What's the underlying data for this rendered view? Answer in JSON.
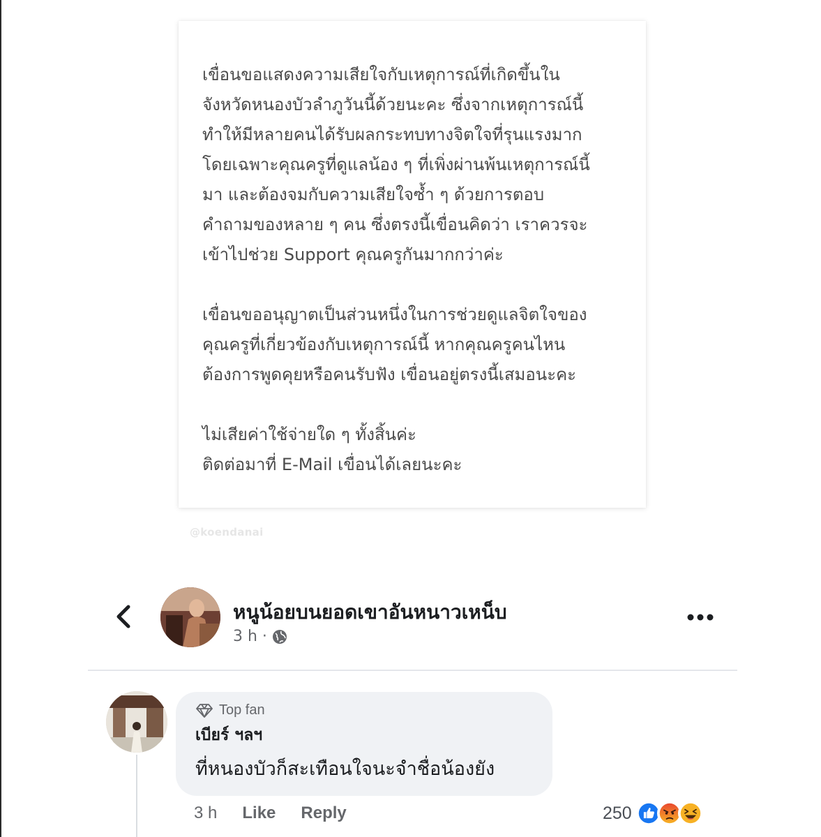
{
  "statement": {
    "paragraphs": [
      "เขื่อนขอแสดงความเสียใจกับเหตุการณ์ที่เกิดขึ้นใน\nจังหวัดหนองบัวลำภูวันนี้ด้วยนะคะ ซึ่งจากเหตุการณ์นี้\nทำให้มีหลายคนได้รับผลกระทบทางจิตใจที่รุนแรงมาก\nโดยเฉพาะคุณครูที่ดูแลน้อง ๆ ที่เพิ่งผ่านพ้นเหตุการณ์นี้\nมา และต้องจมกับความเสียใจซ้ำ ๆ ด้วยการตอบ\nคำถามของหลาย ๆ คน ซึ่งตรงนี้เขื่อนคิดว่า เราควรจะ\nเข้าไปช่วย Support คุณครูกันมากกว่าค่ะ",
      "เขื่อนขออนุญาตเป็นส่วนหนึ่งในการช่วยดูแลจิตใจของ\nคุณครูที่เกี่ยวข้องกับเหตุการณ์นี้  หากคุณครูคนไหน\nต้องการพูดคุยหรือคนรับฟัง เขื่อนอยู่ตรงนี้เสมอนะคะ",
      "ไม่เสียค่าใช้จ่ายใด ๆ ทั้งสิ้นค่ะ\nติดต่อมาที่ E-Mail เขื่อนได้เลยนะคะ"
    ]
  },
  "watermark": "@koendanai",
  "post": {
    "author": "หนูน้อยบนยอดเขาอันหนาวเหน็บ",
    "time": "3 h ·",
    "icons": {
      "back": "chevron-left-icon",
      "privacy": "globe-icon",
      "more": "more-horizontal-icon"
    }
  },
  "comment": {
    "badge": "Top fan",
    "author": "เบียร์ ฯลฯ",
    "text": "ที่หนองบัวก็สะเทือนใจนะจำชื่อน้องยัง",
    "time": "3 h",
    "like_label": "Like",
    "reply_label": "Reply",
    "reaction_count": "250",
    "reactions": [
      "like",
      "angry",
      "haha"
    ],
    "colors": {
      "like": "#1877f2",
      "angry": "#e9710f",
      "haha": "#f7b125"
    }
  }
}
